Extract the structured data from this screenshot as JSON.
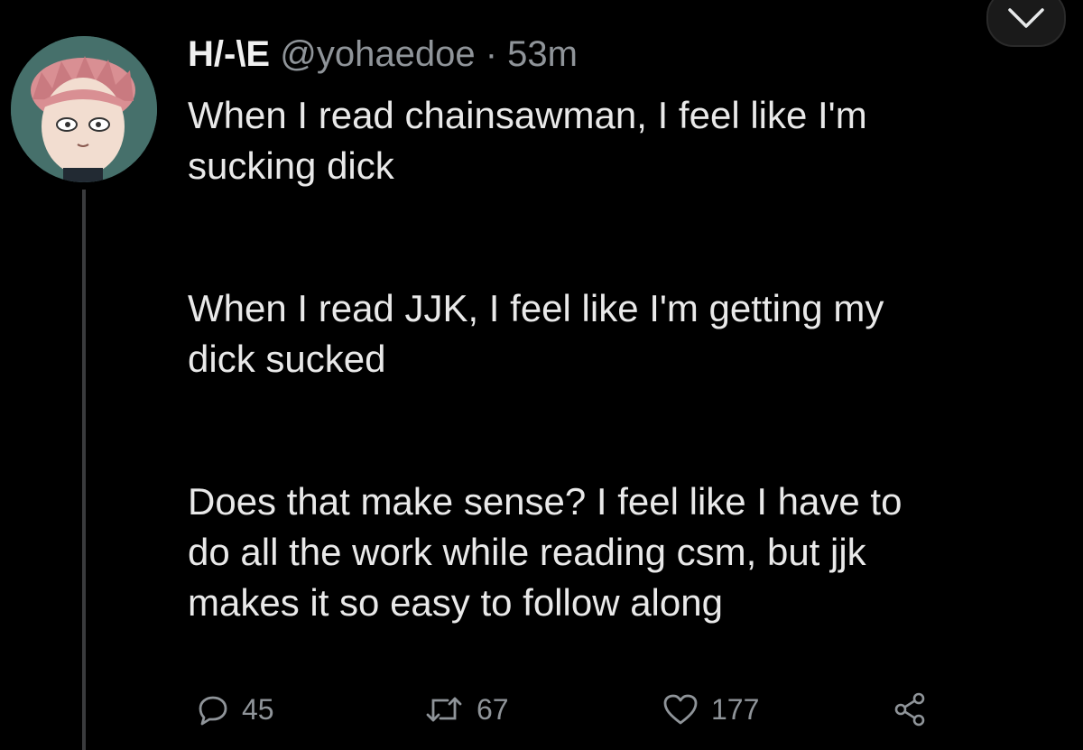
{
  "tweet": {
    "display_name": "H/-\\E",
    "handle": "@yohaedoe",
    "separator": "·",
    "timestamp": "53m",
    "paragraphs": [
      [
        "When I read chainsawman, I feel like I'm",
        "sucking dick"
      ],
      [
        "When I read JJK, I feel like I'm getting my",
        "dick sucked"
      ],
      [
        "Does that make sense? I feel like I have to",
        "do all the work while reading csm, but jjk",
        "makes it so easy to follow along"
      ]
    ]
  },
  "actions": {
    "reply_count": "45",
    "retweet_count": "67",
    "like_count": "177"
  },
  "icons": {
    "avatar": "anime-avatar",
    "menu": "chevron-down-icon",
    "reply": "reply-icon",
    "retweet": "retweet-icon",
    "like": "heart-icon",
    "share": "share-icon"
  },
  "colors": {
    "background": "#000000",
    "text": "#e9e9e9",
    "muted": "#8f9499",
    "thread_line": "#3a3b3d"
  }
}
